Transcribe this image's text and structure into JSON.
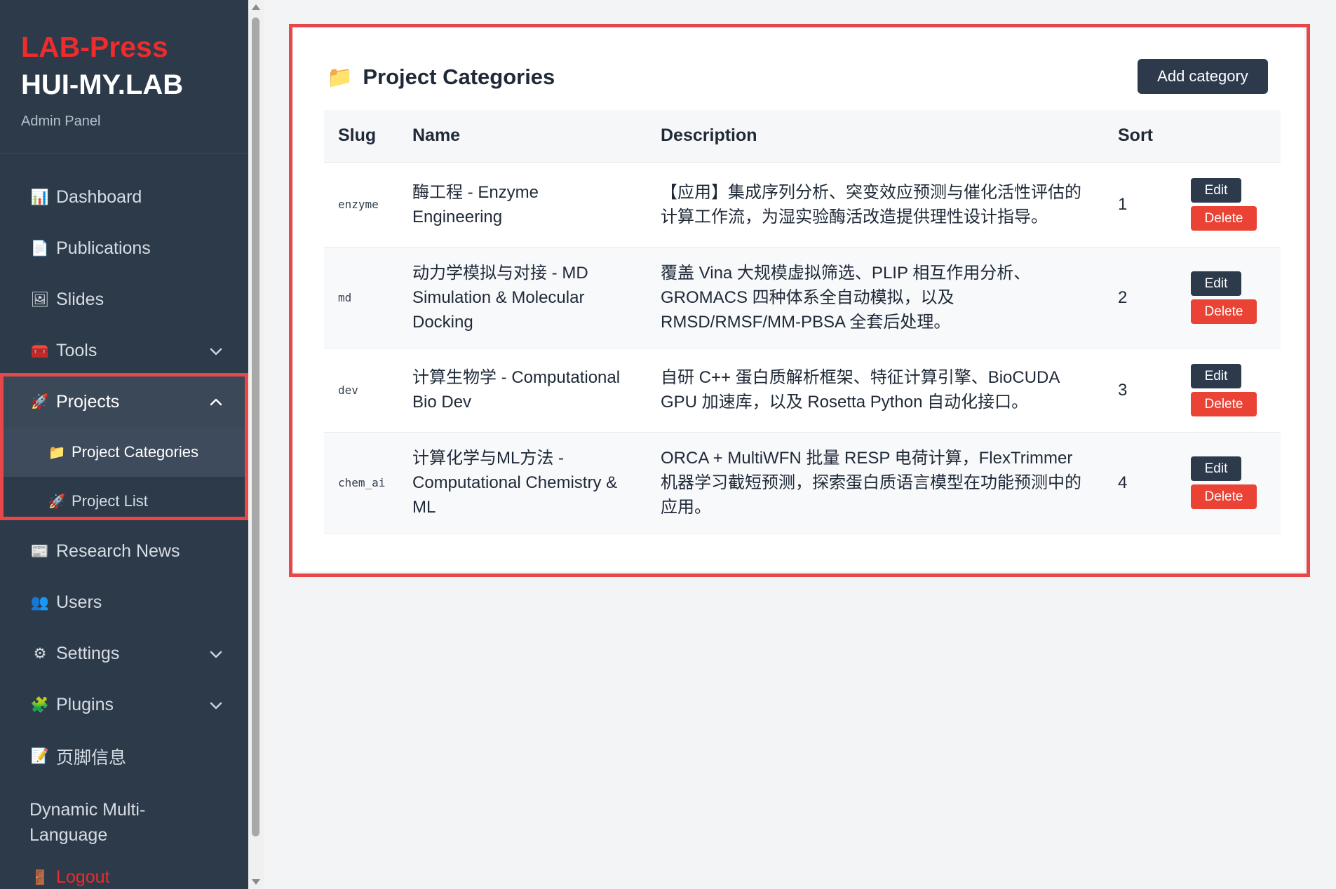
{
  "brand": {
    "lab": "LAB-Press",
    "site": "HUI-MY.LAB",
    "subtitle": "Admin Panel"
  },
  "sidebar": {
    "items": [
      {
        "label": "Dashboard",
        "icon": "chart-icon",
        "glyph": "📊"
      },
      {
        "label": "Publications",
        "icon": "document-icon",
        "glyph": "📄"
      },
      {
        "label": "Slides",
        "icon": "picture-icon",
        "glyph": "🖼"
      },
      {
        "label": "Tools",
        "icon": "toolbox-icon",
        "glyph": "🧰"
      },
      {
        "label": "Projects",
        "icon": "rocket-icon",
        "glyph": "🚀"
      },
      {
        "label": "Research News",
        "icon": "newspaper-icon",
        "glyph": "📰"
      },
      {
        "label": "Users",
        "icon": "users-icon",
        "glyph": "👥"
      },
      {
        "label": "Settings",
        "icon": "gear-icon",
        "glyph": "⚙"
      },
      {
        "label": "Plugins",
        "icon": "puzzle-icon",
        "glyph": "🧩"
      },
      {
        "label": "页脚信息",
        "icon": "memo-icon",
        "glyph": "📝"
      },
      {
        "label": "Dynamic Multi-Language"
      },
      {
        "label": "Logout",
        "icon": "door-icon",
        "glyph": "🚪"
      }
    ],
    "projects_sub": [
      {
        "label": "Project Categories",
        "icon": "folder-icon",
        "glyph": "📁"
      },
      {
        "label": "Project List",
        "icon": "rocket-icon",
        "glyph": "🚀"
      }
    ]
  },
  "main": {
    "title": "Project Categories",
    "title_glyph": "📁",
    "add_button": "Add category",
    "columns": {
      "slug": "Slug",
      "name": "Name",
      "description": "Description",
      "sort": "Sort"
    },
    "edit_label": "Edit",
    "delete_label": "Delete",
    "rows": [
      {
        "slug": "enzyme",
        "name": "酶工程 - Enzyme Engineering",
        "description": "【应用】集成序列分析、突变效应预测与催化活性评估的计算工作流，为湿实验酶活改造提供理性设计指导。",
        "sort": "1"
      },
      {
        "slug": "md",
        "name": "动力学模拟与对接 - MD Simulation & Molecular Docking",
        "description": "覆盖 Vina 大规模虚拟筛选、PLIP 相互作用分析、GROMACS 四种体系全自动模拟，以及 RMSD/RMSF/MM-PBSA 全套后处理。",
        "sort": "2"
      },
      {
        "slug": "dev",
        "name": "计算生物学 - Computational Bio Dev",
        "description": "自研 C++ 蛋白质解析框架、特征计算引擎、BioCUDA GPU 加速库，以及 Rosetta Python 自动化接口。",
        "sort": "3"
      },
      {
        "slug": "chem_ai",
        "name": "计算化学与ML方法 - Computational Chemistry & ML",
        "description": "ORCA + MultiWFN 批量 RESP 电荷计算，FlexTrimmer 机器学习截短预测，探索蛋白质语言模型在功能预测中的应用。",
        "sort": "4"
      }
    ]
  },
  "colors": {
    "sidebar": "#2d3a4a",
    "brand_red": "#ef2b2b",
    "primary_button": "#2c3a4c",
    "danger_button": "#ea4335",
    "highlight": "#e8474a"
  }
}
